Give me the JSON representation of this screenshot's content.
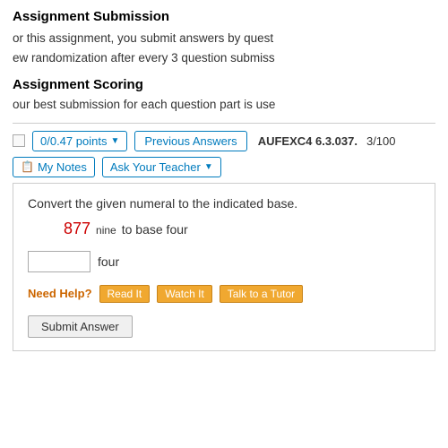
{
  "header": {
    "assignment_title": "Assignment Submission",
    "line1": "or this assignment, you submit answers by quest",
    "line2": "ew randomization after every 3 question submiss",
    "scoring_title": "Assignment Scoring",
    "scoring_text": "our best submission for each question part is use"
  },
  "toolbar": {
    "points_label": "0/0.47 points",
    "chevron": "▼",
    "prev_answers_label": "Previous Answers",
    "code_label": "AUFEXC4 6.3.037.",
    "page_count": "3/100",
    "notes_label": "My Notes",
    "ask_teacher_label": "Ask Your Teacher",
    "ask_chevron": "▼"
  },
  "question": {
    "text": "Convert the given numeral to the indicated base.",
    "numeral": "877",
    "subscript": "nine",
    "to_base": "to base four",
    "answer_unit": "four",
    "input_placeholder": ""
  },
  "help": {
    "label": "Need Help?",
    "read_it": "Read It",
    "watch_it": "Watch It",
    "talk_to_tutor": "Talk to a Tutor"
  },
  "submit": {
    "label": "Submit Answer"
  }
}
